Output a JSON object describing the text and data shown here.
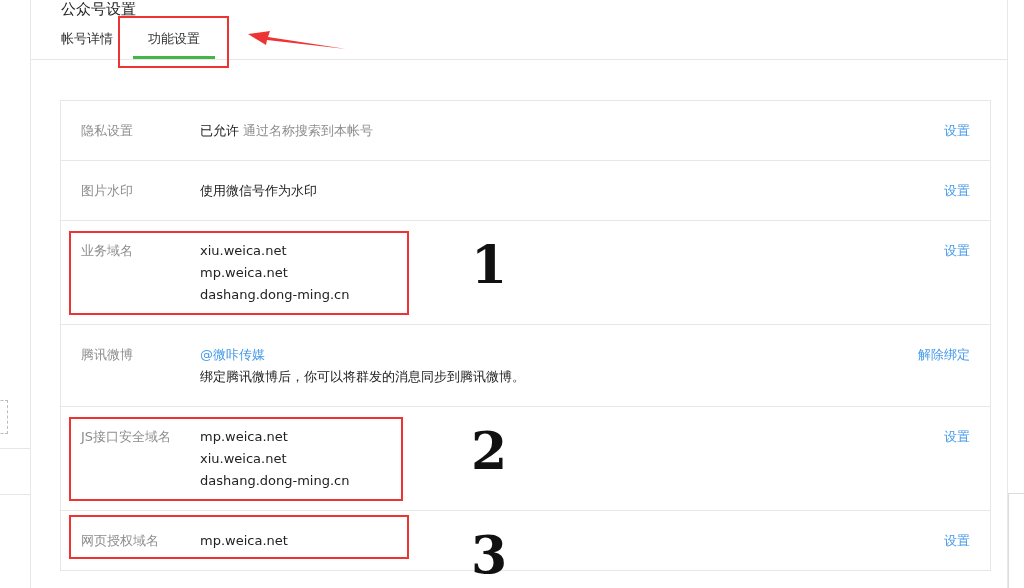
{
  "page_title": "公众号设置",
  "tabs": [
    {
      "label": "帐号详情",
      "selected": false,
      "highlighted": false
    },
    {
      "label": "功能设置",
      "selected": true,
      "highlighted": true
    }
  ],
  "settings": [
    {
      "kind": "status",
      "label": "隐私设置",
      "status": "已允许",
      "note": "通过名称搜索到本帐号",
      "action": "设置",
      "highlighted": false
    },
    {
      "kind": "text",
      "label": "图片水印",
      "lines": [
        "使用微信号作为水印"
      ],
      "action": "设置",
      "highlighted": false
    },
    {
      "kind": "text",
      "label": "业务域名",
      "lines": [
        "xiu.weica.net",
        "mp.weica.net",
        "dashang.dong-ming.cn"
      ],
      "action": "设置",
      "highlighted": true,
      "marker": "1"
    },
    {
      "kind": "weibo",
      "label": "腾讯微博",
      "account": "@微咔传媒",
      "note": "绑定腾讯微博后，你可以将群发的消息同步到腾讯微博。",
      "action": "解除绑定",
      "highlighted": false
    },
    {
      "kind": "text",
      "label": "JS接口安全域名",
      "lines": [
        "mp.weica.net",
        "xiu.weica.net",
        "dashang.dong-ming.cn"
      ],
      "action": "设置",
      "highlighted": true,
      "marker": "2"
    },
    {
      "kind": "text",
      "label": "网页授权域名",
      "lines": [
        "mp.weica.net"
      ],
      "action": "设置",
      "highlighted": true,
      "marker": "3"
    }
  ]
}
